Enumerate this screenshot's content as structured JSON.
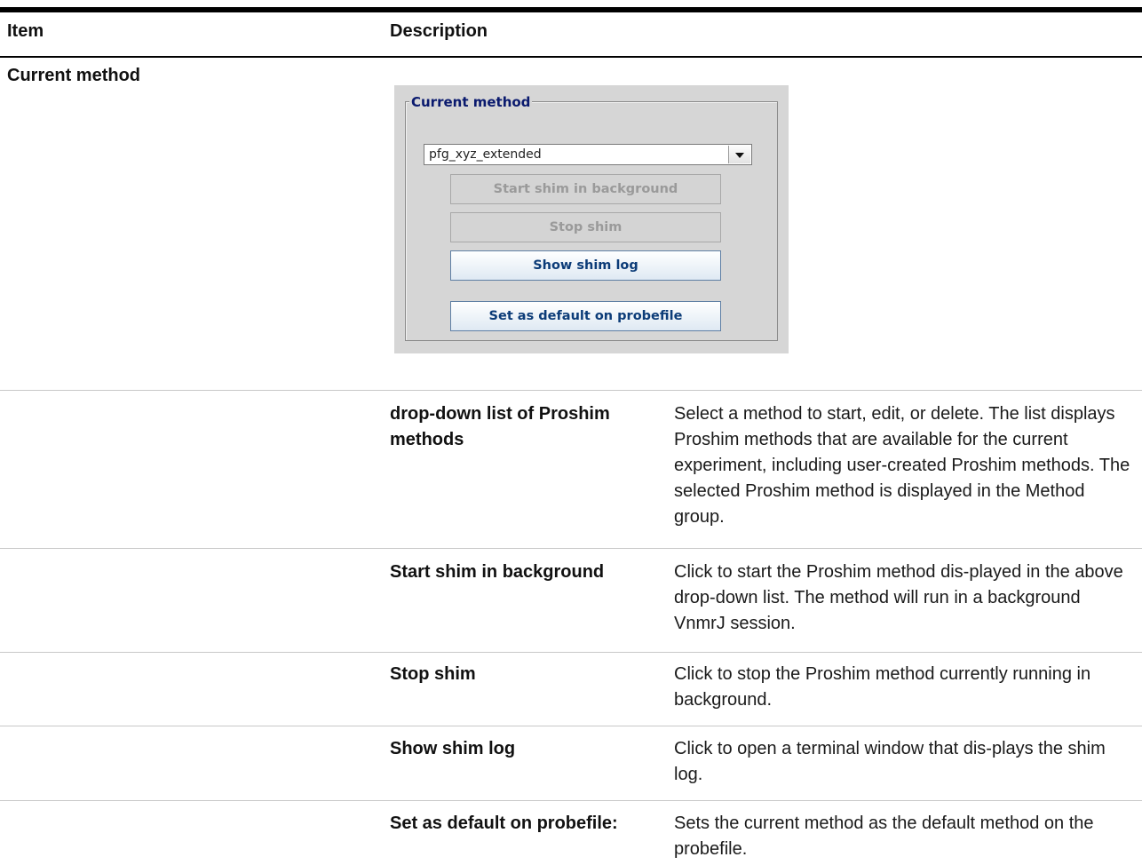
{
  "table": {
    "headers": {
      "item": "Item",
      "description": "Description"
    },
    "section_label": "Current method"
  },
  "panel": {
    "group_title": "Current method",
    "dropdown_value": "pfg_xyz_extended",
    "buttons": {
      "start": "Start shim in background",
      "stop": "Stop shim",
      "show_log": "Show shim log",
      "set_default": "Set as default on probefile"
    }
  },
  "rows": [
    {
      "term": "drop-down list of Proshim methods",
      "desc": "Select a method to start, edit, or delete. The list displays Proshim methods that are available for the current experiment, including user-created Proshim methods. The selected Proshim method is displayed in the Method group."
    },
    {
      "term": "Start shim in background",
      "desc": "Click to start the Proshim method dis-played in the above drop-down list. The method will run in a background VnmrJ session."
    },
    {
      "term": "Stop shim",
      "desc": "Click to stop the Proshim method currently running in background."
    },
    {
      "term": "Show shim log",
      "desc": "Click to open a terminal window that dis-plays the shim log."
    },
    {
      "term": "Set as default on probefile:",
      "desc": "Sets the current method as the default method on the probefile."
    }
  ]
}
